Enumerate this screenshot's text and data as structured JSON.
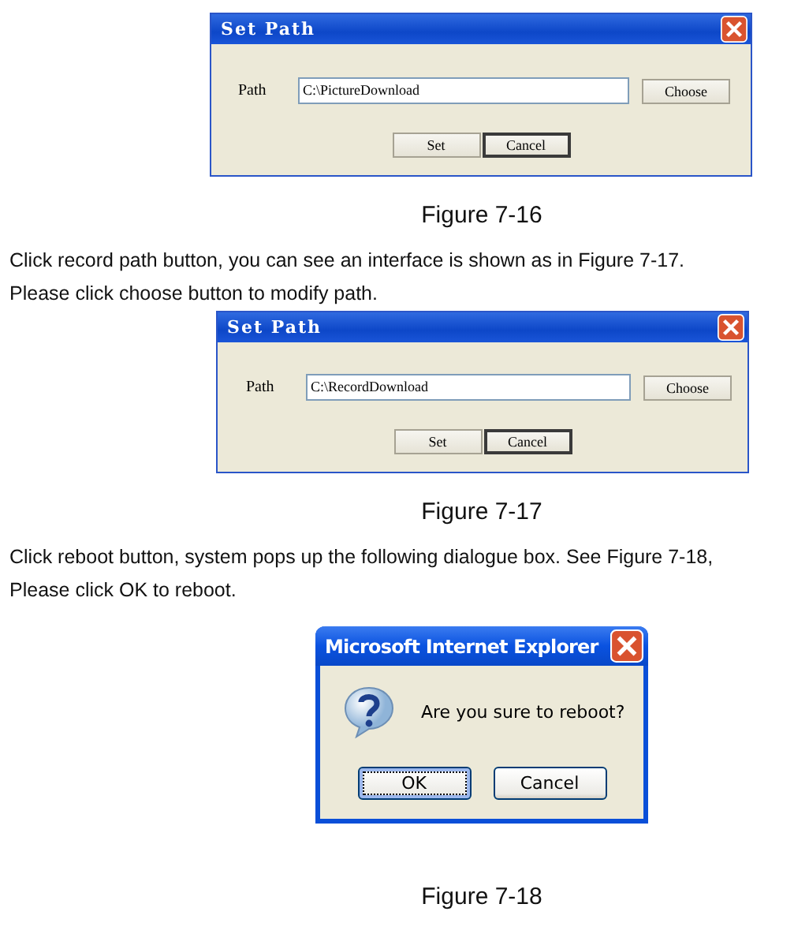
{
  "blocks": [
    {
      "kind": "path_dialog",
      "title": "Set Path",
      "label": "Path",
      "value": "C:\\PictureDownload",
      "buttons": [
        {
          "label": "Choose",
          "default": false
        }
      ],
      "actions": [
        {
          "label": "Set",
          "default": false
        },
        {
          "label": "Cancel",
          "default": true
        }
      ]
    },
    {
      "kind": "caption",
      "text": "Figure 7-16"
    },
    {
      "kind": "paragraph",
      "lines": [
        "Click record path button, you can see an interface is shown as in Figure 7-17.",
        "Please click choose button to modify path."
      ]
    },
    {
      "kind": "path_dialog",
      "title": "Set Path",
      "label": "Path",
      "value": "C:\\RecordDownload",
      "buttons": [
        {
          "label": "Choose",
          "default": false
        }
      ],
      "actions": [
        {
          "label": "Set",
          "default": false
        },
        {
          "label": "Cancel",
          "default": true
        }
      ]
    },
    {
      "kind": "caption",
      "text": "Figure 7-17"
    },
    {
      "kind": "paragraph",
      "lines": [
        "Click reboot button, system pops up the following dialogue box. See Figure 7-18,",
        "Please click OK to reboot."
      ]
    },
    {
      "kind": "confirm_dialog",
      "title": "Microsoft Internet Explorer",
      "message": "Are you sure to reboot?",
      "actions": [
        {
          "label": "OK",
          "default": true
        },
        {
          "label": "Cancel",
          "default": false
        }
      ]
    },
    {
      "kind": "caption",
      "text": "Figure 7-18"
    }
  ]
}
